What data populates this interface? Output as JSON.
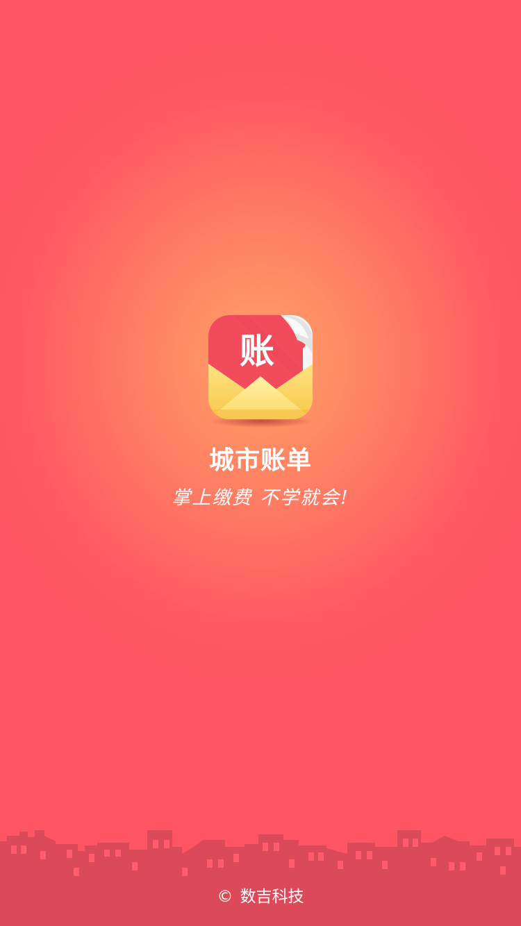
{
  "app": {
    "icon_char": "账",
    "icon_name": "bill-envelope-icon",
    "title": "城市账单",
    "slogan": "掌上缴费 不学就会!"
  },
  "footer": {
    "copyright_symbol": "©",
    "company": "数吉科技"
  },
  "colors": {
    "background_center": "#ffa468",
    "background_edge": "#fe5463",
    "skyline": "#db4a58",
    "skyline_window": "#ff5d6c",
    "icon_red": "#f24b5c",
    "envelope_yellow": "#fcdb6a"
  }
}
